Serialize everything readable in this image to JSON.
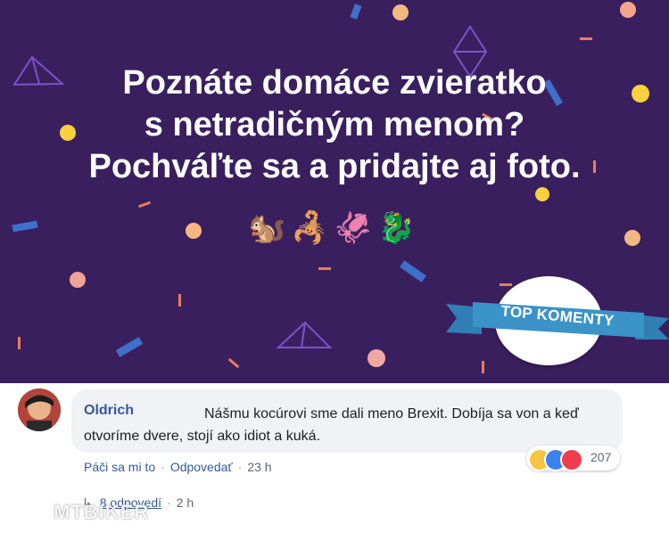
{
  "banner": {
    "line1": "Poznáte domáce zvieratko",
    "line2": "s netradičným menom?",
    "line3": "Pochváľte sa a pridajte aj foto.",
    "emojis": [
      "🐿️",
      "🦂",
      "🦑",
      "🐉"
    ],
    "badge": "TOP KOMENTY",
    "colors": {
      "background": "#3a1f5e",
      "ribbon": "#3b93c7",
      "text": "#ffffff"
    }
  },
  "comment": {
    "author": "Oldrich",
    "text": "Nášmu kocúrovi sme dali meno Brexit. Dobíja sa von a keď otvoríme dvere, stojí ako idiot a kuká.",
    "reaction_count": "207",
    "reactions": [
      "haha-icon",
      "like-icon",
      "love-icon"
    ],
    "actions": {
      "like": "Páči sa mi to",
      "reply": "Odpovedať",
      "time": "23 h"
    },
    "replies": {
      "label": "8 odpovedí",
      "time": "2 h"
    }
  },
  "watermark": {
    "text": "MTBIKER"
  }
}
